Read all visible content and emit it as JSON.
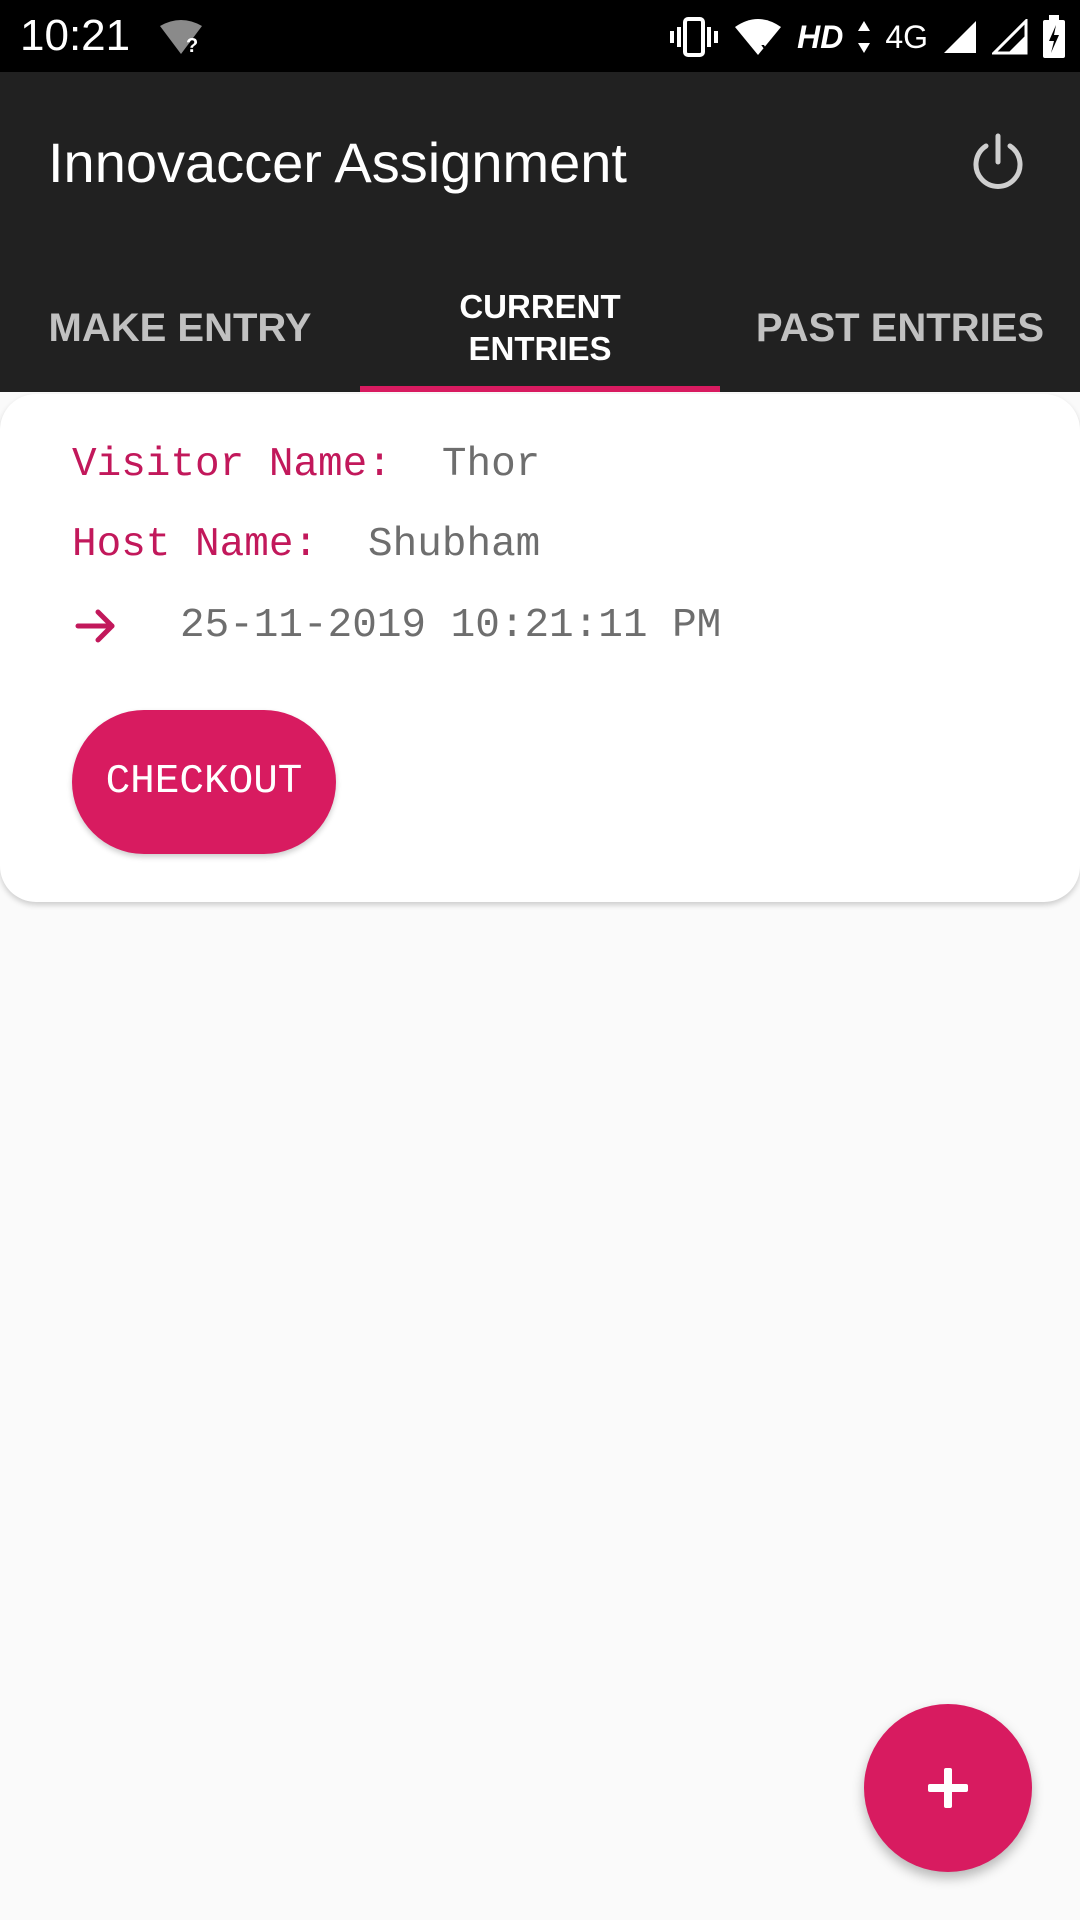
{
  "status_bar": {
    "time": "10:21",
    "network_label": "HD",
    "signal_label": "4G",
    "icons": [
      "wifi-question-icon",
      "vibrate-icon",
      "wifi-x-icon",
      "data-arrows-icon",
      "signal-icon",
      "signal-icon",
      "battery-charging-icon"
    ]
  },
  "app_bar": {
    "title": "Innovaccer Assignment",
    "power_icon": "power-icon"
  },
  "tabs": [
    {
      "label": "MAKE ENTRY",
      "active": false
    },
    {
      "label": "CURRENT ENTRIES",
      "active": true
    },
    {
      "label": "PAST ENTRIES",
      "active": false
    }
  ],
  "entry": {
    "visitor_label": "Visitor Name:",
    "visitor_value": "Thor",
    "host_label": "Host Name:",
    "host_value": "Shubham",
    "timestamp": "25-11-2019 10:21:11 PM",
    "checkout_label": "CHECKOUT"
  },
  "fab": {
    "icon": "plus-icon"
  },
  "colors": {
    "accent": "#d81b60",
    "app_bar": "#212121",
    "label": "#c2185b",
    "value": "#6e6e6e"
  }
}
